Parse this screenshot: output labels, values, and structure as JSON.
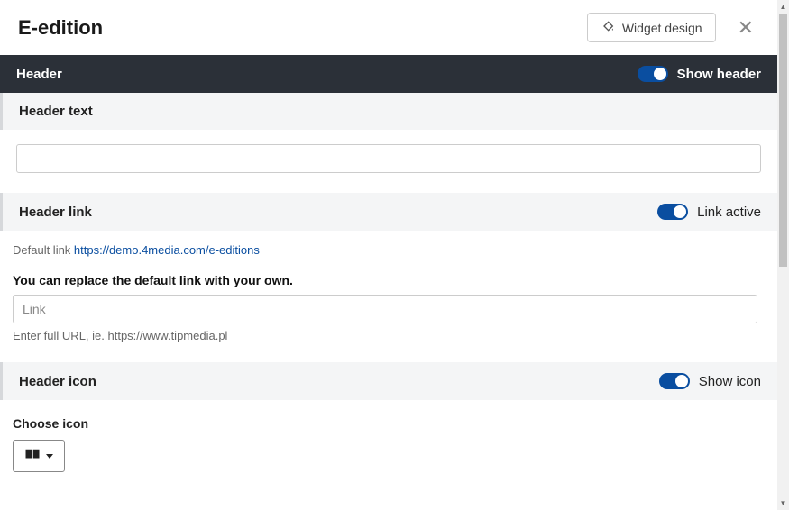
{
  "title": "E-edition",
  "widget_design_label": "Widget design",
  "header_bar": {
    "label": "Header",
    "toggle_label": "Show header",
    "toggle_on": true
  },
  "header_text_section": {
    "label": "Header text",
    "value": ""
  },
  "header_link_section": {
    "label": "Header link",
    "toggle_label": "Link active",
    "toggle_on": true,
    "default_link_prefix": "Default link ",
    "default_link_url": "https://demo.4media.com/e-editions",
    "replace_text": "You can replace the default link with your own.",
    "link_placeholder": "Link",
    "link_value": "",
    "hint": "Enter full URL, ie. https://www.tipmedia.pl"
  },
  "header_icon_section": {
    "label": "Header icon",
    "toggle_label": "Show icon",
    "toggle_on": true,
    "choose_label": "Choose icon",
    "selected_icon": "book-open-icon"
  }
}
